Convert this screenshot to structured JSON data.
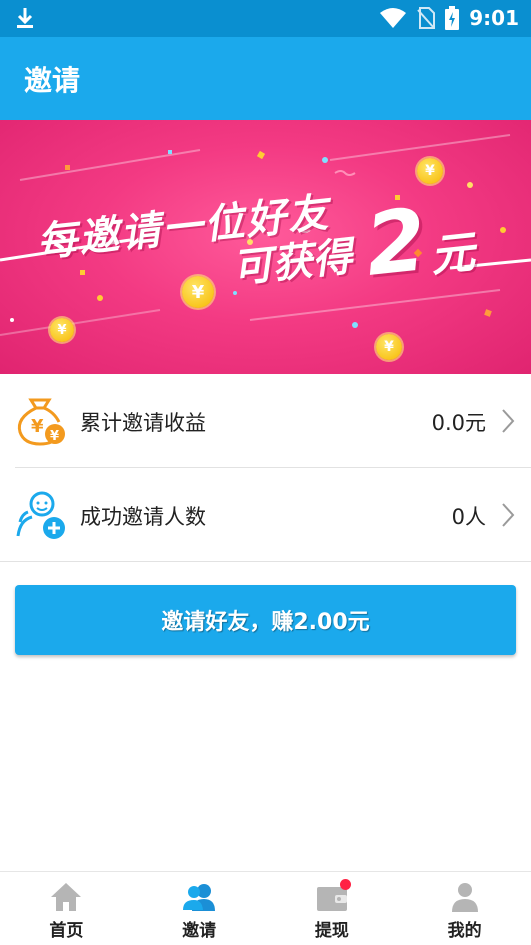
{
  "status_bar": {
    "time": "9:01"
  },
  "app_bar": {
    "title": "邀请"
  },
  "banner": {
    "line1": "每邀请一位好友",
    "line2": "可获得",
    "amount": "2",
    "unit": "元"
  },
  "rows": [
    {
      "label": "累计邀请收益",
      "value": "0.0元",
      "icon": "money-bag-icon"
    },
    {
      "label": "成功邀请人数",
      "value": "0人",
      "icon": "add-friend-icon"
    }
  ],
  "invite_button": {
    "label": "邀请好友，赚2.00元"
  },
  "bottom_nav": [
    {
      "label": "首页",
      "icon": "home-icon"
    },
    {
      "label": "邀请",
      "icon": "friends-icon",
      "active": true
    },
    {
      "label": "提现",
      "icon": "wallet-icon",
      "badge": true
    },
    {
      "label": "我的",
      "icon": "user-icon"
    }
  ],
  "colors": {
    "primary": "#1ba9ec",
    "status_bar": "#0a8fd0",
    "banner_pink": "#f33a83",
    "coin_gold": "#f6b800",
    "row_icon_orange": "#f39a1e",
    "row_icon_blue": "#1ba9ec",
    "nav_inactive": "#b5b5b5",
    "badge_red": "#ff2244"
  }
}
